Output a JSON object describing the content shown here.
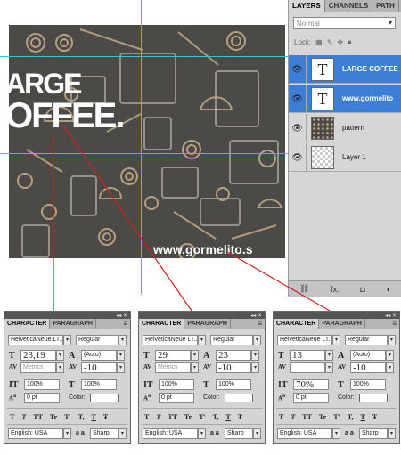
{
  "canvas": {
    "heading_line1": "ARGE",
    "heading_line2": "OFFEE.",
    "url_text": "www.gormelito.s"
  },
  "layers_panel": {
    "tabs": [
      "LAYERS",
      "CHANNELS",
      "PATH"
    ],
    "blend_mode": "Normal",
    "lock_label": "Lock:",
    "layers": [
      {
        "name": "LARGE COFFEE",
        "thumb": "T",
        "selected": true
      },
      {
        "name": "www.gormelito",
        "thumb": "T",
        "selected": true
      },
      {
        "name": "pattern",
        "thumb": "",
        "selected": false
      },
      {
        "name": "Layer 1",
        "thumb": "",
        "selected": false
      }
    ],
    "footer_icons": [
      "link-icon",
      "fx-icon",
      "mask-icon",
      "adjustment-icon"
    ],
    "footer_fx": "fx."
  },
  "char_panels": [
    {
      "tab_character": "CHARACTER",
      "tab_paragraph": "PARAGRAPH",
      "font_family": "HelveticaNeue LT...",
      "font_style": "Regular",
      "font_size": "23,19",
      "leading": "(Auto)",
      "kerning": "Metrics",
      "tracking": "-10",
      "vertical_scale": "100%",
      "horizontal_scale": "100%",
      "baseline_shift": "0 pt",
      "color_label": "Color:",
      "style_buttons": [
        "T",
        "T",
        "TT",
        "Tr",
        "T'",
        "T,",
        "T",
        "Ŧ"
      ],
      "language": "English: USA",
      "aa_label": "a a",
      "antialias": "Sharp"
    },
    {
      "tab_character": "CHARACTER",
      "tab_paragraph": "PARAGRAPH",
      "font_family": "HelveticaNeue LT...",
      "font_style": "Regular",
      "font_size": "29",
      "leading": "23",
      "kerning": "Metrics",
      "tracking": "-10",
      "vertical_scale": "100%",
      "horizontal_scale": "100%",
      "baseline_shift": "0 pt",
      "color_label": "Color:",
      "style_buttons": [
        "T",
        "T",
        "TT",
        "Tr",
        "T'",
        "T,",
        "T",
        "Ŧ"
      ],
      "language": "English: USA",
      "aa_label": "a a",
      "antialias": "Sharp"
    },
    {
      "tab_character": "CHARACTER",
      "tab_paragraph": "PARAGRAPH",
      "font_family": "HelveticaNeue LT...",
      "font_style": "Regular",
      "font_size": "13",
      "leading": "(Auto)",
      "kerning": "",
      "tracking": "-10",
      "vertical_scale": "70%",
      "horizontal_scale": "100%",
      "baseline_shift": "0 pt",
      "color_label": "Color:",
      "style_buttons": [
        "T",
        "T",
        "TT",
        "Tr",
        "T'",
        "T,",
        "T",
        "Ŧ"
      ],
      "language": "English: USA",
      "aa_label": "a a",
      "antialias": "Sharp"
    }
  ],
  "colors": {
    "canvas_bg": "#4b4a47",
    "pattern_tan": "#c9b08b",
    "guide": "#35c3d6",
    "selection": "#3d7fd6",
    "leader_line": "#d02020"
  }
}
